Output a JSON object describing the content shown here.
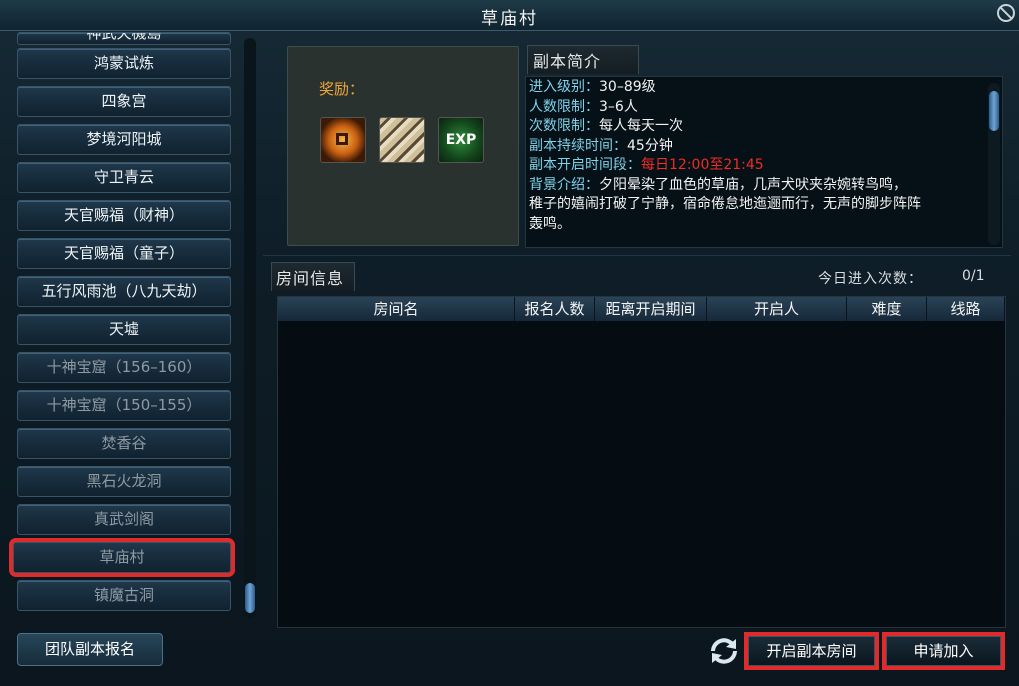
{
  "window": {
    "title": "草庙村"
  },
  "dungeon_list": {
    "items": [
      {
        "label": "神武天機島",
        "state": "cut"
      },
      {
        "label": "鸿蒙试炼",
        "state": "normal"
      },
      {
        "label": "四象宫",
        "state": "normal"
      },
      {
        "label": "梦境河阳城",
        "state": "normal"
      },
      {
        "label": "守卫青云",
        "state": "normal"
      },
      {
        "label": "天官赐福（财神）",
        "state": "normal"
      },
      {
        "label": "天官赐福（童子）",
        "state": "normal"
      },
      {
        "label": "五行风雨池（八九天劫）",
        "state": "normal"
      },
      {
        "label": "天墟",
        "state": "normal"
      },
      {
        "label": "十神宝窟（156–160）",
        "state": "dim"
      },
      {
        "label": "十神宝窟（150–155）",
        "state": "dim"
      },
      {
        "label": "焚香谷",
        "state": "dim"
      },
      {
        "label": "黑石火龙洞",
        "state": "dim"
      },
      {
        "label": "真武剑阁",
        "state": "dim"
      },
      {
        "label": "草庙村",
        "state": "selected"
      },
      {
        "label": "镇魔古洞",
        "state": "dim"
      }
    ],
    "team_signup_label": "团队副本报名"
  },
  "reward": {
    "label": "奖励：",
    "icons": [
      {
        "name": "coin-icon"
      },
      {
        "name": "claw-material-icon"
      },
      {
        "name": "exp-icon",
        "text": "EXP"
      }
    ]
  },
  "intro": {
    "title": "副本简介",
    "lines": [
      {
        "key": "进入级别：",
        "val": "30–89级"
      },
      {
        "key": "人数限制：",
        "val": "3–6人"
      },
      {
        "key": "次数限制：",
        "val": "每人每天一次"
      },
      {
        "key": "副本持续时间：",
        "val": "45分钟"
      },
      {
        "key": "副本开启时间段：",
        "val": "每日12:00至21:45"
      },
      {
        "key": "背景介绍：",
        "val": "夕阳晕染了血色的草庙，几声犬吠夹杂婉转鸟鸣，"
      },
      {
        "key": "",
        "val": "稚子的嬉闹打破了宁静，宿命倦怠地迤逦而行，无声的脚步阵阵"
      },
      {
        "key": "",
        "val": "轰鸣。"
      }
    ]
  },
  "room": {
    "title": "房间信息",
    "today_label": "今日进入次数：",
    "today_count": "0/1",
    "columns": [
      "房间名",
      "报名人数",
      "距离开启期间",
      "开启人",
      "难度",
      "线路"
    ]
  },
  "buttons": {
    "open_room": "开启副本房间",
    "apply_join": "申请加入"
  },
  "colors": {
    "key_text": "#7ed2ea",
    "time_red": "#ef2b24",
    "highlight_border": "#e12a2a",
    "reward_label": "#f0a638"
  }
}
